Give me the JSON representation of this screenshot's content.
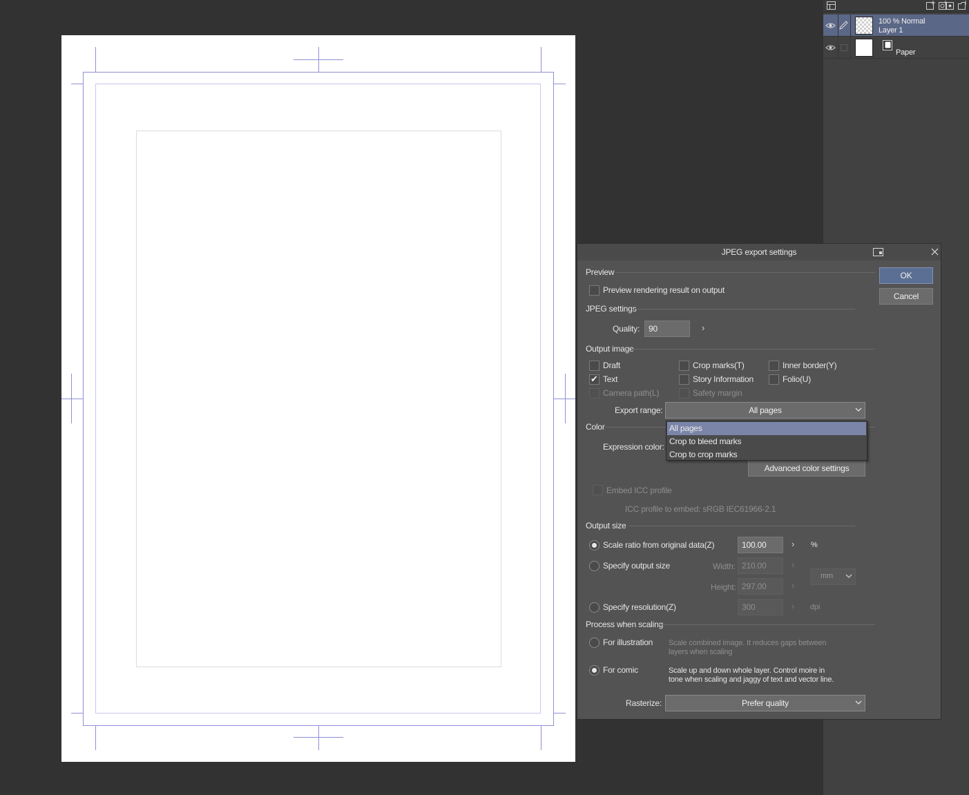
{
  "layer_panel": {
    "layers": [
      {
        "name": "Layer 1",
        "blend": "100 % Normal",
        "thumb": "transparent-checker",
        "selected": true
      },
      {
        "name": "Paper",
        "thumb": "white",
        "selected": false
      }
    ],
    "toolbar_icons": [
      "layer-property-icon",
      "new-raster-layer-icon",
      "new-vector-layer-icon",
      "new-tone-layer-icon",
      "new-folder-icon"
    ]
  },
  "dialog": {
    "title": "JPEG export settings",
    "ok_label": "OK",
    "cancel_label": "Cancel",
    "preview": {
      "section": "Preview",
      "checkbox_label": "Preview rendering result on output",
      "checked": false
    },
    "jpeg": {
      "section": "JPEG settings",
      "quality_label": "Quality:",
      "quality_value": "90"
    },
    "output_image": {
      "section": "Output image",
      "options": [
        {
          "label": "Draft",
          "checked": false,
          "enabled": true
        },
        {
          "label": "Crop marks(T)",
          "checked": false,
          "enabled": true
        },
        {
          "label": "Inner border(Y)",
          "checked": false,
          "enabled": true
        },
        {
          "label": "Text",
          "checked": true,
          "enabled": true
        },
        {
          "label": "Story Information",
          "checked": false,
          "enabled": true
        },
        {
          "label": "Folio(U)",
          "checked": false,
          "enabled": true
        },
        {
          "label": "Camera path(L)",
          "checked": false,
          "enabled": false
        },
        {
          "label": "Safety margin",
          "checked": false,
          "enabled": false
        }
      ],
      "export_range_label": "Export range:",
      "export_range_value": "All pages",
      "export_range_options": [
        "All pages",
        "Crop to bleed marks",
        "Crop to crop marks"
      ]
    },
    "color": {
      "section": "Color",
      "expression_label": "Expression color:",
      "advanced_button": "Advanced color settings",
      "embed_icc_label": "Embed ICC profile",
      "icc_profile_text": "ICC profile to embed:  sRGB IEC61966-2.1"
    },
    "output_size": {
      "section": "Output size",
      "scale_label": "Scale ratio from original data(Z)",
      "scale_value": "100.00",
      "scale_unit": "%",
      "specify_size_label": "Specify output size",
      "width_label": "Width:",
      "width_value": "210.00",
      "height_label": "Height:",
      "height_value": "297.00",
      "unit_value": "mm",
      "resolution_label": "Specify resolution(Z)",
      "resolution_value": "300",
      "resolution_unit": "dpi",
      "selected": "scale"
    },
    "process": {
      "section": "Process when scaling",
      "illustration_label": "For illustration",
      "illustration_desc_1": "Scale combined image. It reduces gaps between",
      "illustration_desc_2": "layers when scaling",
      "comic_label": "For comic",
      "comic_desc_1": "Scale up and down whole layer. Control moire in",
      "comic_desc_2": "tone when scaling and jaggy of text and vector line.",
      "selected": "comic",
      "rasterize_label": "Rasterize:",
      "rasterize_value": "Prefer quality"
    }
  }
}
